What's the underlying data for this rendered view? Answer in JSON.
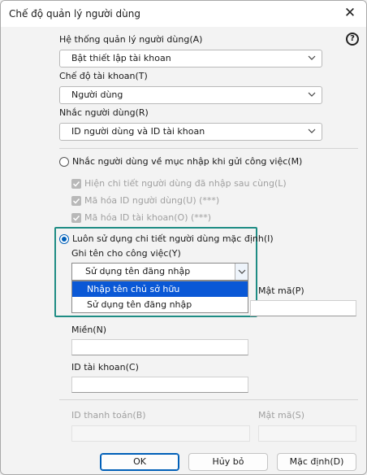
{
  "window": {
    "title": "Chế độ quản lý người dùng",
    "close_glyph": "✕",
    "help_glyph": "?"
  },
  "system": {
    "label": "Hệ thống quản lý người dùng(A)",
    "value": "Bật thiết lập tài khoan"
  },
  "account_mode": {
    "label": "Chế độ tài khoan(T)",
    "value": "Người dùng"
  },
  "user_prompt": {
    "label": "Nhắc người dùng(R)",
    "value": "ID người dùng và ID tài khoan"
  },
  "radio_prompt": {
    "label": "Nhắc người dùng về mục nhập khi gửi công việc(M)"
  },
  "checks": [
    {
      "label": "Hiện chi tiết người dùng đã nhập sau cùng(L)"
    },
    {
      "label": "Mã hóa ID người dùng(U) (***)"
    },
    {
      "label": "Mã hóa ID tài khoan(O) (***)"
    }
  ],
  "radio_always": {
    "label": "Luôn sử dụng chi tiết người dùng mặc định(I)"
  },
  "job_name": {
    "label": "Ghi tên cho công việc(Y)",
    "value": "Sử dụng tên đăng nhập",
    "options": [
      "Nhập tên chủ sở hữu",
      "Sử dụng tên đăng nhập"
    ]
  },
  "fields": {
    "password_label": "Mật mã(P)",
    "domain_label": "Miền(N)",
    "account_id_label": "ID tài khoan(C)",
    "billing_id_label": "ID thanh toán(B)",
    "billing_password_label": "Mật mã(S)"
  },
  "buttons": {
    "ok": "OK",
    "cancel": "Hủy bỏ",
    "default": "Mặc định(D)"
  },
  "colors": {
    "accent": "#005fb8",
    "highlight_border": "#1e8c84",
    "selected_option": "#0a58d6"
  }
}
